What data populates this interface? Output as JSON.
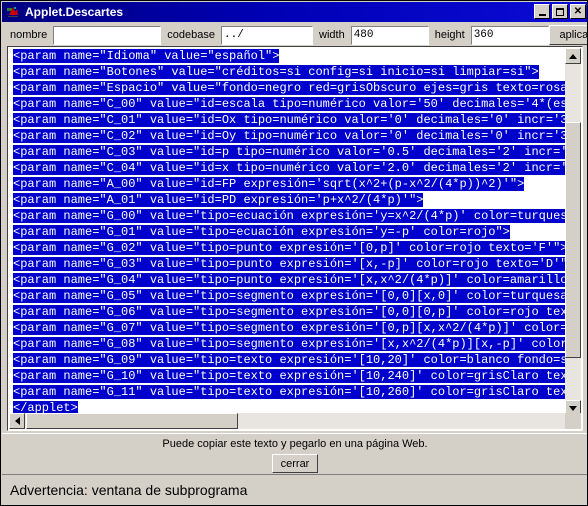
{
  "window": {
    "title": "Applet.Descartes",
    "icon": "applet-icon",
    "controls": {
      "minimize": "minimize-icon",
      "maximize": "maximize-icon",
      "close": "close-icon"
    }
  },
  "toolbar": {
    "nombre_label": "nombre",
    "nombre_value": "",
    "nombre_placeholder": "",
    "codebase_label": "codebase",
    "codebase_value": "../",
    "width_label": "width",
    "width_value": "480",
    "height_label": "height",
    "height_value": "360",
    "apply_label": "aplicar"
  },
  "editor": {
    "lines": [
      "<param name=\"Idioma\" value=\"español\">",
      "<param name=\"Botones\" value=\"créditos=si config=si inicio=si limpiar=si\">",
      "<param name=\"Espacio\" value=\"fondo=negro red=grisObscuro ejes=gris texto=rosa",
      "<param name=\"C_00\" value=\"id=escala tipo=numérico valor='50' decimales='4*(es",
      "<param name=\"C_01\" value=\"id=Ox tipo=numérico valor='0' decimales='0' incr='3",
      "<param name=\"C_02\" value=\"id=Oy tipo=numérico valor='0' decimales='0' incr='3",
      "<param name=\"C_03\" value=\"id=p tipo=numérico valor='0.5' decimales='2' incr='",
      "<param name=\"C_04\" value=\"id=x tipo=numérico valor='2.0' decimales='2' incr='",
      "<param name=\"A_00\" value=\"id=FP expresión='sqrt(x^2+(p-x^2/(4*p))^2)'\">",
      "<param name=\"A_01\" value=\"id=PD expresión='p+x^2/(4*p)'\">",
      "<param name=\"G_00\" value=\"tipo=ecuación expresión='y=x^2/(4*p)' color=turques",
      "<param name=\"G_01\" value=\"tipo=ecuación expresión='y=-p' color=rojo\">",
      "<param name=\"G_02\" value=\"tipo=punto expresión='[0,p]' color=rojo texto='F'\">",
      "<param name=\"G_03\" value=\"tipo=punto expresión='[x,-p]' color=rojo texto='D'\"",
      "<param name=\"G_04\" value=\"tipo=punto expresión='[x,x^2/(4*p)]' color=amarillo",
      "<param name=\"G_05\" value=\"tipo=segmento expresión='[0,0][x,0]' color=turquesa",
      "<param name=\"G_06\" value=\"tipo=segmento expresión='[0,0][0,p]' color=rojo tex",
      "<param name=\"G_07\" value=\"tipo=segmento expresión='[0,p][x,x^2/(4*p)]' color=",
      "<param name=\"G_08\" value=\"tipo=segmento expresión='[x,x^2/(4*p)][x,-p]' color",
      "<param name=\"G_09\" value=\"tipo=texto expresión='[10,20]' color=blanco fondo=s",
      "<param name=\"G_10\" value=\"tipo=texto expresión='[10,240]' color=grisClaro tex",
      "<param name=\"G_11\" value=\"tipo=texto expresión='[10,260]' color=grisClaro tex",
      "</applet>"
    ],
    "selection_color": "#0000cc",
    "text_color": "#ffffff",
    "background_color": "#ffffff"
  },
  "scrollbars": {
    "vertical": {
      "up_arrow": "scroll-up-icon",
      "down_arrow": "scroll-down-icon"
    },
    "horizontal": {
      "left_arrow": "scroll-left-icon",
      "right_arrow": "scroll-right-icon"
    }
  },
  "footer": {
    "hint": "Puede copiar este texto y pegarlo en una página Web.",
    "close_label": "cerrar"
  },
  "statusbar": {
    "message": "Advertencia: ventana de subprograma"
  }
}
